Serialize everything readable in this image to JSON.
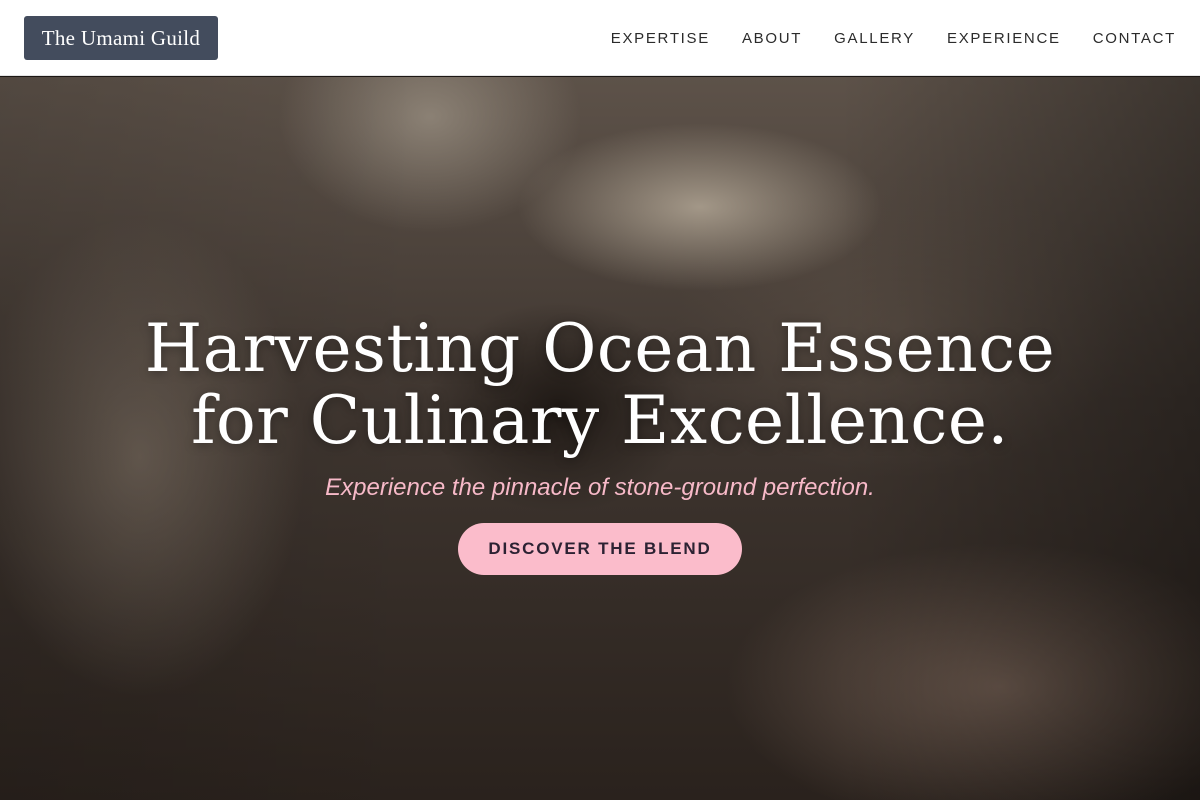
{
  "brand": {
    "name": "The Umami Guild"
  },
  "nav": {
    "links": [
      "EXPERTISE",
      "ABOUT",
      "GALLERY",
      "EXPERIENCE",
      "CONTACT"
    ]
  },
  "hero": {
    "title_line1": "Harvesting Ocean Essence",
    "title_line2": "for Culinary Excellence.",
    "subtitle": "Experience the pinnacle of stone-ground perfection.",
    "cta_label": "DISCOVER THE BLEND",
    "background_description_icon": "flour-dust-hands-photo"
  },
  "colors": {
    "nav_bg": "#ffffff",
    "logo_bg": "#434c5d",
    "accent_pink": "#fbbccb",
    "subtitle_pink": "#f7b9c8",
    "hero_text": "#ffffff"
  }
}
